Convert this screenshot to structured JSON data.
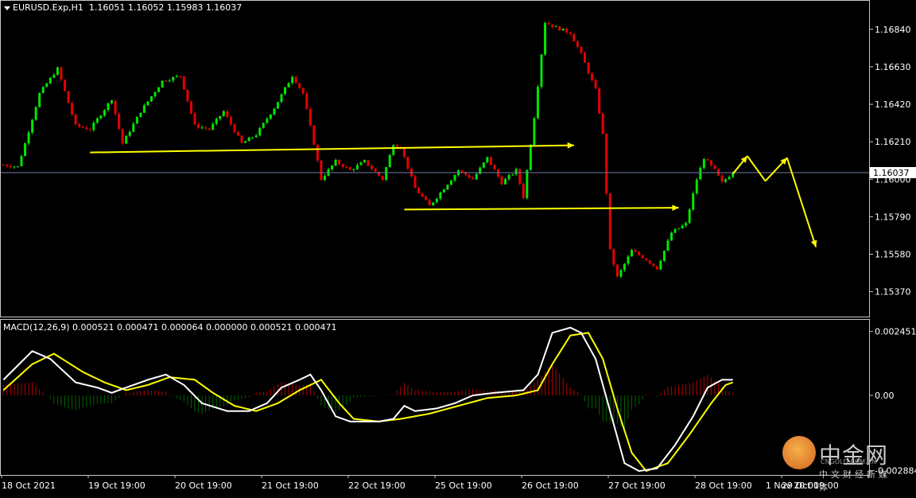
{
  "main_header": {
    "symbol": "EURUSD.Exp,H1",
    "ohlc": "1.16051 1.16052 1.15983 1.16037"
  },
  "macd_header": {
    "text": "MACD(12,26,9) 0.000521 0.000471 0.000064 0.000000 0.000521 0.000471"
  },
  "watermark": {
    "cn": "中金网",
    "en": "CNGOLD.COM.CN",
    "sub": "中文财经新媒体"
  },
  "colors": {
    "bull": "#00e600",
    "bear": "#e60000",
    "arrow": "#ffff00",
    "macd_line": "#ffffff",
    "signal_line": "#ffff00",
    "hist_pos": "#b40000",
    "hist_neg": "#006400",
    "grid": "#6e7ba8",
    "text": "#ffffff"
  },
  "chart_data": [
    {
      "type": "candlestick",
      "symbol": "EURUSD",
      "timeframe": "H1",
      "y_ticks": [
        "1.16840",
        "1.16630",
        "1.16420",
        "1.16210",
        "1.16000",
        "1.15790",
        "1.15580",
        "1.15370"
      ],
      "ylim": [
        1.1523,
        1.17
      ],
      "current_price": "1.16037",
      "x_ticks": [
        "18 Oct 2021",
        "19 Oct 19:00",
        "20 Oct 19:00",
        "21 Oct 19:00",
        "22 Oct 19:00",
        "25 Oct 19:00",
        "26 Oct 19:00",
        "27 Oct 19:00",
        "28 Oct 19:00",
        "29 Oct 19:00",
        "1 Nov 20:00"
      ],
      "close_path": [
        [
          0,
          1.1608
        ],
        [
          4,
          1.1607
        ],
        [
          6,
          1.162
        ],
        [
          10,
          1.1648
        ],
        [
          15,
          1.1662
        ],
        [
          20,
          1.163
        ],
        [
          24,
          1.1628
        ],
        [
          30,
          1.1645
        ],
        [
          33,
          1.162
        ],
        [
          38,
          1.1638
        ],
        [
          44,
          1.1655
        ],
        [
          49,
          1.1658
        ],
        [
          53,
          1.163
        ],
        [
          57,
          1.1628
        ],
        [
          61,
          1.1638
        ],
        [
          66,
          1.162
        ],
        [
          70,
          1.1625
        ],
        [
          75,
          1.164
        ],
        [
          80,
          1.1658
        ],
        [
          83,
          1.1648
        ],
        [
          86,
          1.162
        ],
        [
          88,
          1.16
        ],
        [
          92,
          1.161
        ],
        [
          96,
          1.1605
        ],
        [
          100,
          1.161
        ],
        [
          105,
          1.16
        ],
        [
          108,
          1.162
        ],
        [
          110,
          1.1618
        ],
        [
          114,
          1.1595
        ],
        [
          118,
          1.1585
        ],
        [
          122,
          1.1595
        ],
        [
          126,
          1.1605
        ],
        [
          130,
          1.16
        ],
        [
          134,
          1.1612
        ],
        [
          138,
          1.1598
        ],
        [
          142,
          1.1605
        ],
        [
          144,
          1.159
        ],
        [
          147,
          1.1635
        ],
        [
          150,
          1.1688
        ],
        [
          153,
          1.1685
        ],
        [
          157,
          1.1682
        ],
        [
          160,
          1.167
        ],
        [
          164,
          1.165
        ],
        [
          166,
          1.1625
        ],
        [
          168,
          1.156
        ],
        [
          170,
          1.1545
        ],
        [
          174,
          1.156
        ],
        [
          178,
          1.1555
        ],
        [
          181,
          1.155
        ],
        [
          185,
          1.157
        ],
        [
          189,
          1.1575
        ],
        [
          192,
          1.16
        ],
        [
          194,
          1.1612
        ],
        [
          197,
          1.1605
        ],
        [
          199,
          1.1598
        ],
        [
          202,
          1.1604
        ]
      ],
      "arrows": [
        {
          "from": [
            24,
            1.1615
          ],
          "to": [
            158,
            1.1619
          ]
        },
        {
          "from": [
            111,
            1.1583
          ],
          "to": [
            187,
            1.1584
          ]
        },
        {
          "from": [
            202,
            1.1603
          ],
          "to": [
            206,
            1.1613
          ]
        },
        {
          "from": [
            206,
            1.1613
          ],
          "to": [
            211,
            1.1599
          ]
        },
        {
          "from": [
            211,
            1.1599
          ],
          "to": [
            217,
            1.1612
          ]
        },
        {
          "from": [
            217,
            1.1612
          ],
          "to": [
            225,
            1.1562
          ]
        }
      ]
    },
    {
      "type": "macd",
      "params": "MACD(12,26,9)",
      "y_ticks": [
        "0.002451",
        "0.00",
        "-0.002884"
      ],
      "ylim": [
        -0.00305,
        0.0029
      ],
      "macd": [
        [
          0,
          0.0006
        ],
        [
          8,
          0.0017
        ],
        [
          13,
          0.0014
        ],
        [
          20,
          0.0005
        ],
        [
          26,
          0.0003
        ],
        [
          30,
          0.0001
        ],
        [
          34,
          0.0003
        ],
        [
          40,
          0.0006
        ],
        [
          45,
          0.0008
        ],
        [
          50,
          0.0004
        ],
        [
          55,
          -0.0003
        ],
        [
          62,
          -0.0006
        ],
        [
          68,
          -0.0006
        ],
        [
          73,
          -0.0003
        ],
        [
          77,
          0.0003
        ],
        [
          82,
          0.0006
        ],
        [
          85,
          0.0008
        ],
        [
          88,
          0.0002
        ],
        [
          92,
          -0.0008
        ],
        [
          96,
          -0.001
        ],
        [
          104,
          -0.001
        ],
        [
          108,
          -0.0009
        ],
        [
          111,
          -0.0004
        ],
        [
          114,
          -0.0006
        ],
        [
          120,
          -0.0005
        ],
        [
          125,
          -0.0003
        ],
        [
          130,
          0.0
        ],
        [
          136,
          0.0001
        ],
        [
          144,
          0.0002
        ],
        [
          148,
          0.0008
        ],
        [
          152,
          0.0024
        ],
        [
          157,
          0.0026
        ],
        [
          160,
          0.0024
        ],
        [
          164,
          0.0014
        ],
        [
          168,
          -0.0006
        ],
        [
          172,
          -0.0026
        ],
        [
          176,
          -0.0029
        ],
        [
          181,
          -0.0028
        ],
        [
          186,
          -0.0019
        ],
        [
          191,
          -0.0008
        ],
        [
          195,
          0.0003
        ],
        [
          199,
          0.0006
        ],
        [
          202,
          0.0006
        ]
      ],
      "signal": [
        [
          0,
          0.0002
        ],
        [
          8,
          0.0012
        ],
        [
          14,
          0.0016
        ],
        [
          22,
          0.0009
        ],
        [
          28,
          0.0005
        ],
        [
          34,
          0.0002
        ],
        [
          40,
          0.0004
        ],
        [
          46,
          0.0007
        ],
        [
          53,
          0.0006
        ],
        [
          58,
          0.0001
        ],
        [
          64,
          -0.0004
        ],
        [
          70,
          -0.0006
        ],
        [
          76,
          -0.0003
        ],
        [
          82,
          0.0002
        ],
        [
          88,
          0.0006
        ],
        [
          93,
          -0.0003
        ],
        [
          97,
          -0.0009
        ],
        [
          104,
          -0.001
        ],
        [
          110,
          -0.0009
        ],
        [
          118,
          -0.0007
        ],
        [
          126,
          -0.0004
        ],
        [
          134,
          -0.0001
        ],
        [
          142,
          0.0
        ],
        [
          148,
          0.0002
        ],
        [
          152,
          0.0012
        ],
        [
          157,
          0.0023
        ],
        [
          162,
          0.0024
        ],
        [
          166,
          0.0014
        ],
        [
          170,
          -0.0005
        ],
        [
          174,
          -0.0022
        ],
        [
          178,
          -0.0029
        ],
        [
          184,
          -0.0026
        ],
        [
          190,
          -0.0015
        ],
        [
          196,
          -0.0003
        ],
        [
          200,
          0.0004
        ],
        [
          202,
          0.0005
        ]
      ],
      "histogram_note": "difference between macd and signal, drawn as vertical bars"
    }
  ]
}
